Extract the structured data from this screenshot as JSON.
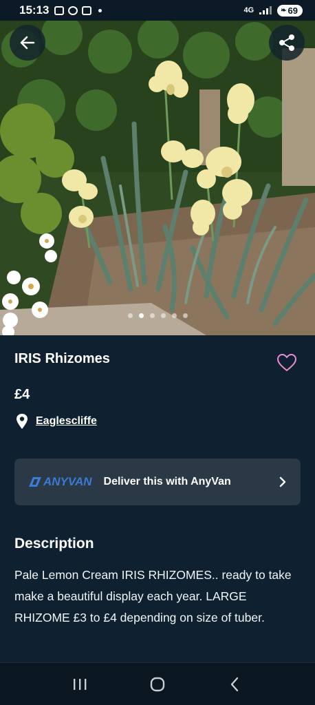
{
  "status_bar": {
    "time": "15:13",
    "network": "4G",
    "battery": "69"
  },
  "listing": {
    "title": "IRIS Rhizomes",
    "price": "£4",
    "location": "Eaglescliffe",
    "image_count": 6,
    "active_image": 1
  },
  "delivery": {
    "brand": "ANYVAN",
    "label": "Deliver this with AnyVan"
  },
  "description": {
    "heading": "Description",
    "body": "Pale Lemon Cream IRIS RHIZOMES.. ready to take make a beautiful display each year. LARGE RHIZOME £3 to £4 depending on size of tuber."
  },
  "colors": {
    "background": "#0f2130",
    "card": "#2a3945",
    "heart": "#ec8fcf",
    "anyvan_blue": "#3a7bd5"
  },
  "icons": [
    "back-arrow-icon",
    "share-icon",
    "heart-icon",
    "location-pin-icon",
    "chevron-right-icon",
    "recent-apps-icon",
    "home-icon",
    "back-icon"
  ]
}
